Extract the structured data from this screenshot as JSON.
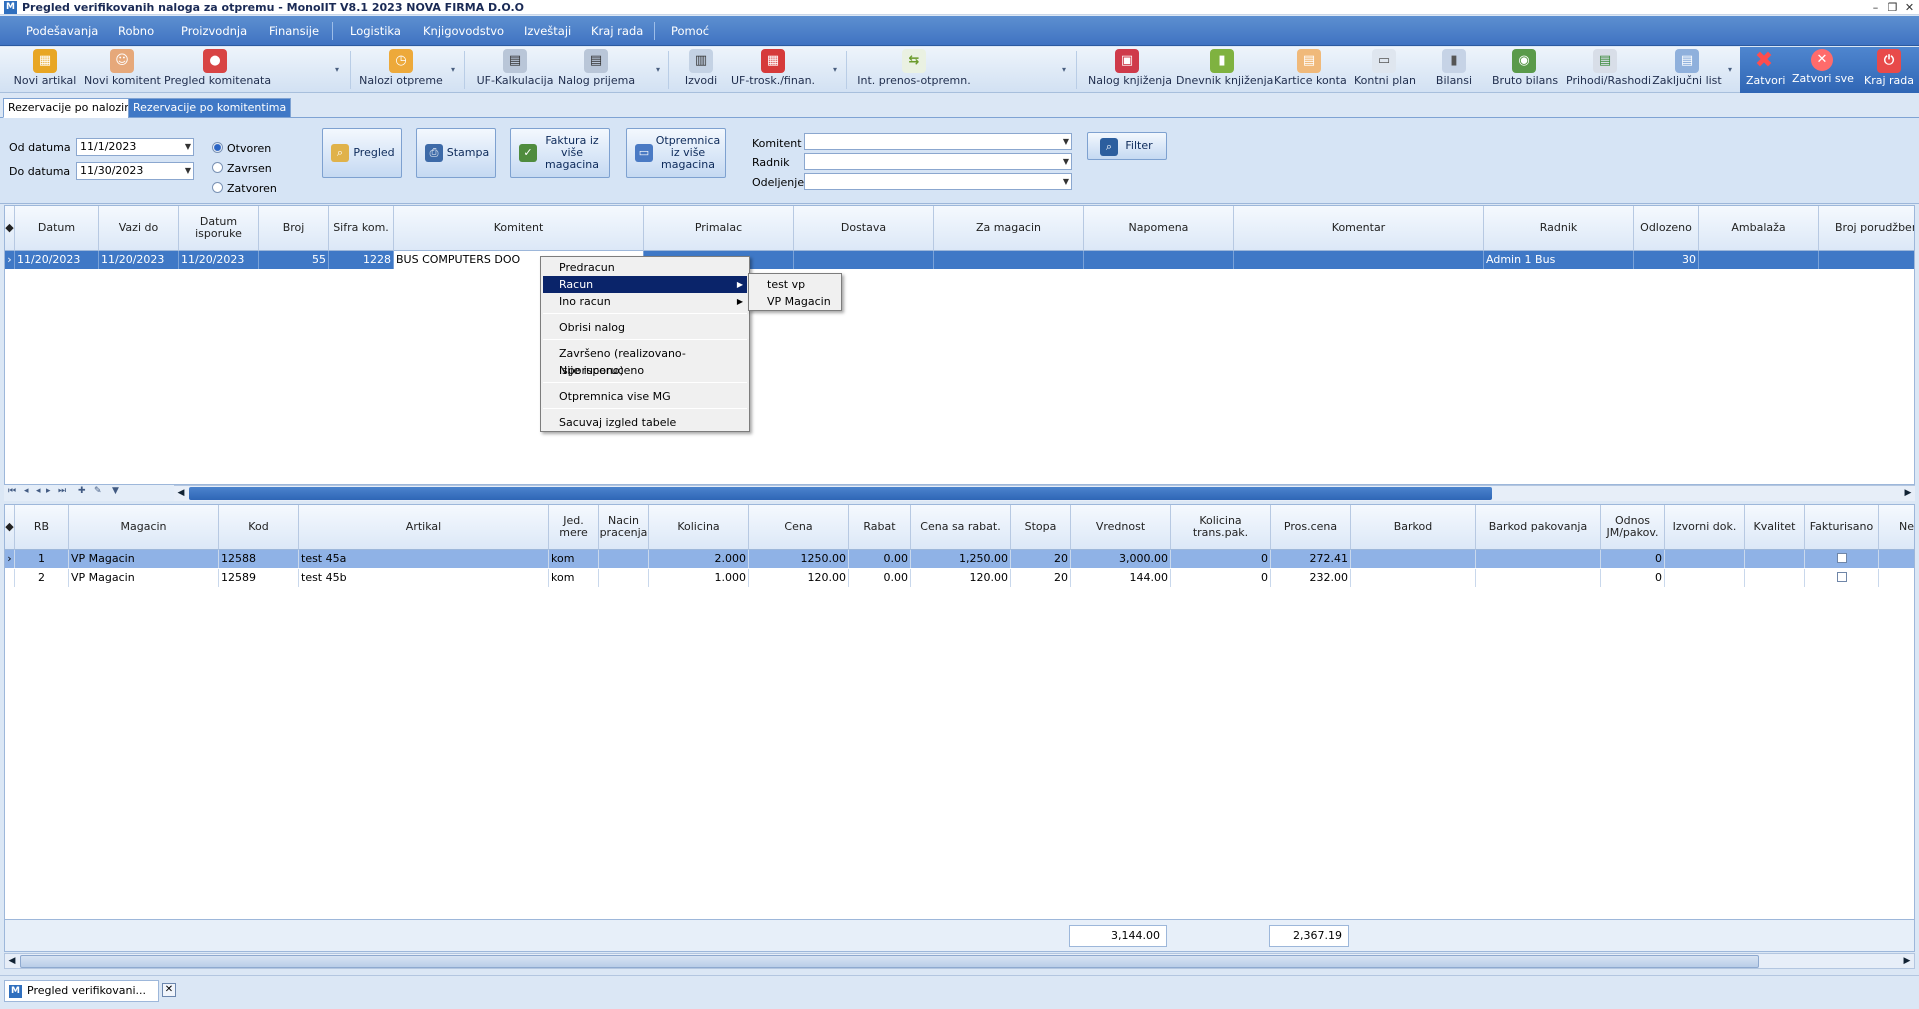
{
  "window": {
    "title": "Pregled verifikovanih naloga za otpremu - MonoIIT V8.1 2023 NOVA FIRMA D.O.O",
    "app_icon": "M"
  },
  "menu": [
    "Podešavanja",
    "Robno",
    "Proizvodnja",
    "Finansije",
    "Logistika",
    "Knjigovodstvo",
    "Izveštaji",
    "Kraj rada",
    "Pomoć"
  ],
  "toolbar": {
    "novi_artikal": "Novi artikal",
    "novi_komitent": "Novi komitent",
    "pregled_komitenata": "Pregled komitenata",
    "nalozi_otpreme": "Nalozi otpreme",
    "uf_kalkulacija": "UF-Kalkulacija",
    "nalog_prijema": "Nalog prijema",
    "izvodi": "Izvodi",
    "uf_trosk": "UF-trosk./finan.",
    "int_prenos": "Int. prenos-otpremn.",
    "nalog_knjizenja": "Nalog knjiženja",
    "dnevnik_knjizenja": "Dnevnik knjiženja",
    "kartice_konta": "Kartice konta",
    "kontni_plan": "Kontni plan",
    "bilansi": "Bilansi",
    "bruto_bilans": "Bruto bilans",
    "prihodi_rashodi": "Prihodi/Rashodi",
    "zakljucni_list": "Zaključni list",
    "zatvori": "Zatvori",
    "zatvori_sve": "Zatvori sve",
    "kraj_rada": "Kraj rada"
  },
  "tabs": [
    "Rezervacije po nalozima",
    "Rezervacije po komitentima"
  ],
  "filter": {
    "od_datuma_label": "Od datuma",
    "od_datuma": "11/1/2023",
    "do_datuma_label": "Do datuma",
    "do_datuma": "11/30/2023",
    "status_options": [
      "Otvoren",
      "Zavrsen",
      "Zatvoren"
    ],
    "pregled": "Pregled",
    "stampa": "Stampa",
    "faktura": "Faktura iz više magacina",
    "otpremnica": "Otpremnica iz više magacina",
    "komitent_label": "Komitent",
    "radnik_label": "Radnik",
    "odeljenje_label": "Odeljenje",
    "filter_btn": "Filter"
  },
  "grid1": {
    "columns": [
      "Datum",
      "Vazi do",
      "Datum isporuke",
      "Broj",
      "Sifra kom.",
      "Komitent",
      "Primalac",
      "Dostava",
      "Za magacin",
      "Napomena",
      "Komentar",
      "Radnik",
      "Odlozeno",
      "Ambalaža",
      "Broj porudžbenic"
    ],
    "rows": [
      {
        "datum": "11/20/2023",
        "vazi_do": "11/20/2023",
        "datum_isporuke": "11/20/2023",
        "broj": "55",
        "sifra_kom": "1228",
        "komitent": "BUS COMPUTERS DOO",
        "radnik": "Admin 1 Bus",
        "odlozeno": "30"
      }
    ]
  },
  "context_menu": {
    "items": [
      "Predracun",
      "Racun",
      "Ino racun",
      "Obrisi nalog",
      "Završeno (realizovano-isporuceno)",
      "Nije isporuceno",
      "Otpremnica vise MG",
      "Sacuvaj izgled tabele"
    ],
    "submenu": [
      "test vp",
      "VP Magacin"
    ]
  },
  "grid2": {
    "columns": [
      "RB",
      "Magacin",
      "Kod",
      "Artikal",
      "Jed. mere",
      "Nacin pracenja",
      "Kolicina",
      "Cena",
      "Rabat",
      "Cena sa rabat.",
      "Stopa",
      "Vrednost",
      "Kolicina trans.pak.",
      "Pros.cena",
      "Barkod",
      "Barkod pakovanja",
      "Odnos JM/pakov.",
      "Izvorni dok.",
      "Kvalitet",
      "Fakturisano",
      "Net"
    ],
    "rows": [
      {
        "rb": "1",
        "magacin": "VP Magacin",
        "kod": "12588",
        "artikal": "test 45a",
        "jm": "kom",
        "kolicina": "2.000",
        "cena": "1250.00",
        "rabat": "0.00",
        "cena_rabat": "1,250.00",
        "stopa": "20",
        "vrednost": "3,000.00",
        "kol_trans": "0",
        "pros_cena": "272.41",
        "odnos": "0"
      },
      {
        "rb": "2",
        "magacin": "VP Magacin",
        "kod": "12589",
        "artikal": "test 45b",
        "jm": "kom",
        "kolicina": "1.000",
        "cena": "120.00",
        "rabat": "0.00",
        "cena_rabat": "120.00",
        "stopa": "20",
        "vrednost": "144.00",
        "kol_trans": "0",
        "pros_cena": "232.00",
        "odnos": "0"
      }
    ],
    "total_vrednost": "3,144.00",
    "total_pros_cena": "2,367.19"
  },
  "status": {
    "doc_tab": "Pregled verifikovani..."
  },
  "colors": {
    "menubar": "#3f73c2",
    "selection": "#3f78c6",
    "context_highlight": "#0a246a"
  }
}
